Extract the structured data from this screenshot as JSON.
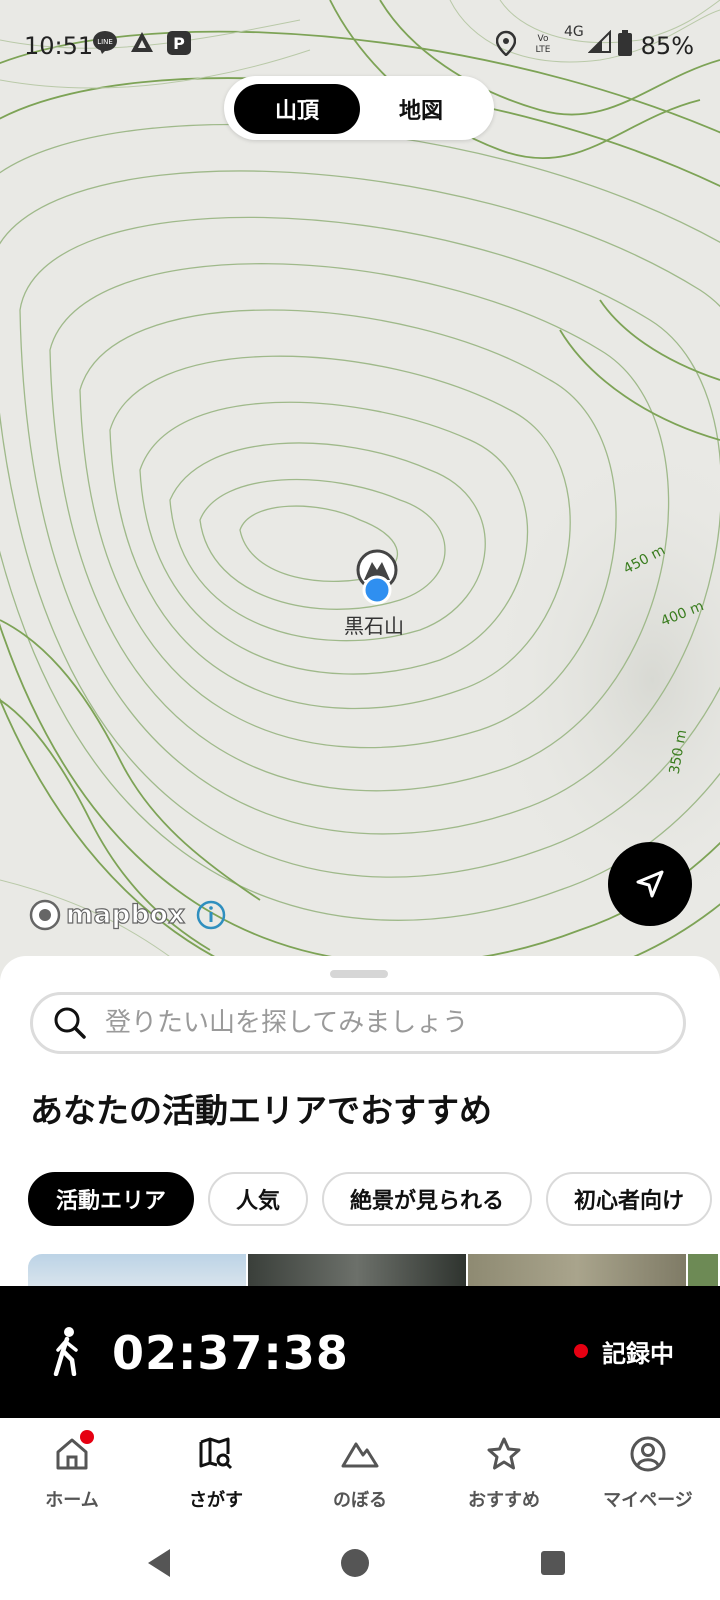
{
  "status_bar": {
    "time": "10:51",
    "battery": "85%",
    "network": "4G",
    "icons": [
      "line-icon",
      "triangle-app-icon",
      "paypay-icon",
      "location-icon",
      "volte-icon",
      "signal-icon",
      "battery-icon"
    ]
  },
  "map": {
    "toggle": {
      "active_label": "山頂",
      "inactive_label": "地図"
    },
    "peak_name": "黒石山",
    "contour_labels": [
      "450 m",
      "400 m",
      "350 m"
    ],
    "attribution": "mapbox",
    "colors": {
      "contour": "#6f9a45",
      "background": "#e9e9e5",
      "user_location": "#2f8ff0"
    }
  },
  "search": {
    "placeholder": "登りたい山を探してみましょう"
  },
  "section_title": "あなたの活動エリアでおすすめ",
  "chips": [
    "活動エリア",
    "人気",
    "絶景が見られる",
    "初心者向け"
  ],
  "recording": {
    "elapsed": "02:37:38",
    "status": "記録中"
  },
  "tabs": [
    {
      "label": "ホーム",
      "icon": "home-icon"
    },
    {
      "label": "さがす",
      "icon": "map-search-icon"
    },
    {
      "label": "のぼる",
      "icon": "mountain-icon"
    },
    {
      "label": "おすすめ",
      "icon": "star-icon"
    },
    {
      "label": "マイページ",
      "icon": "user-icon"
    }
  ],
  "nav": [
    "back-icon",
    "home-circle-icon",
    "recents-icon"
  ]
}
